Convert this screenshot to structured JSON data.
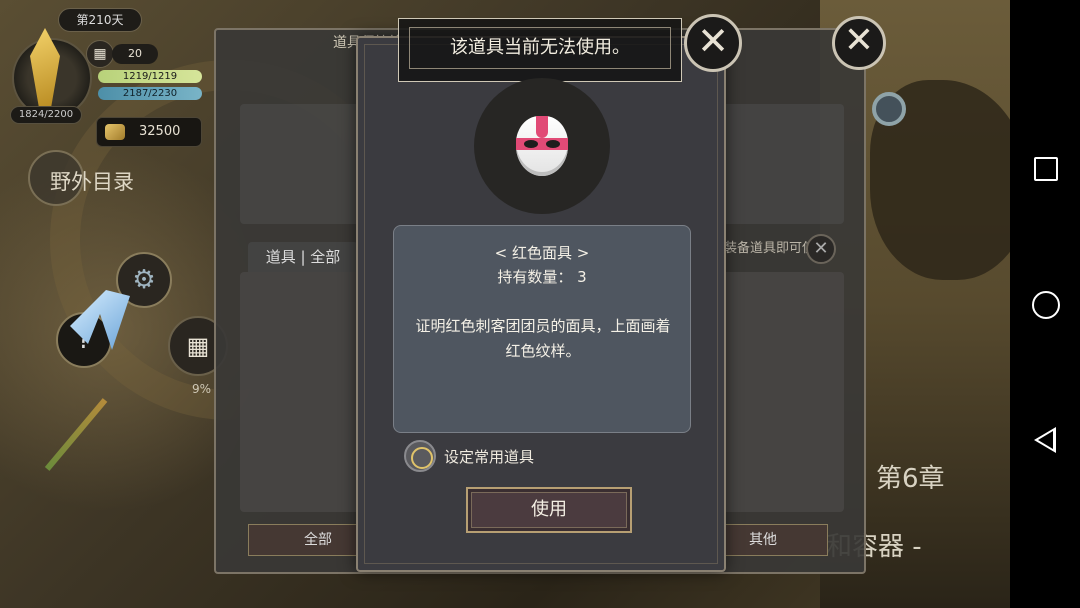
{
  "hud": {
    "day": "第210天",
    "crystal_count": "1824/2200",
    "level": "20",
    "hp": "1219/1219",
    "sp": "2187/2230",
    "gold": "32500",
    "field_label": "野外目录",
    "progress_pct": "9%",
    "chapter": "第6章",
    "chapter_subtitle": "和容器 -"
  },
  "storage_panel": {
    "title": "道具保管箱",
    "tab_label": "道具 | 全部",
    "usage_hint": "装备道具即可使用",
    "filter_all": "全部",
    "filter_other": "其他"
  },
  "dialog": {
    "notice": "该道具当前无法使用。",
    "item_name": "< 红色面具 >",
    "quantity_label": "持有数量：",
    "quantity_value": "3",
    "description": "证明红色刺客团团员的面具，上面画着红色纹样。",
    "favorite_label": "设定常用道具",
    "use_button": "使用"
  },
  "icons": {
    "close": "close-icon",
    "calendar": "calendar-icon",
    "gear": "gear-icon",
    "help": "question-icon",
    "gold": "gold-coin-icon",
    "mask": "red-mask-icon"
  },
  "colors": {
    "accent_pink": "#e14a76",
    "gold_ring": "#e0c36a",
    "hp_bar": "#c6dc88",
    "sp_bar": "#5f9fb6"
  }
}
